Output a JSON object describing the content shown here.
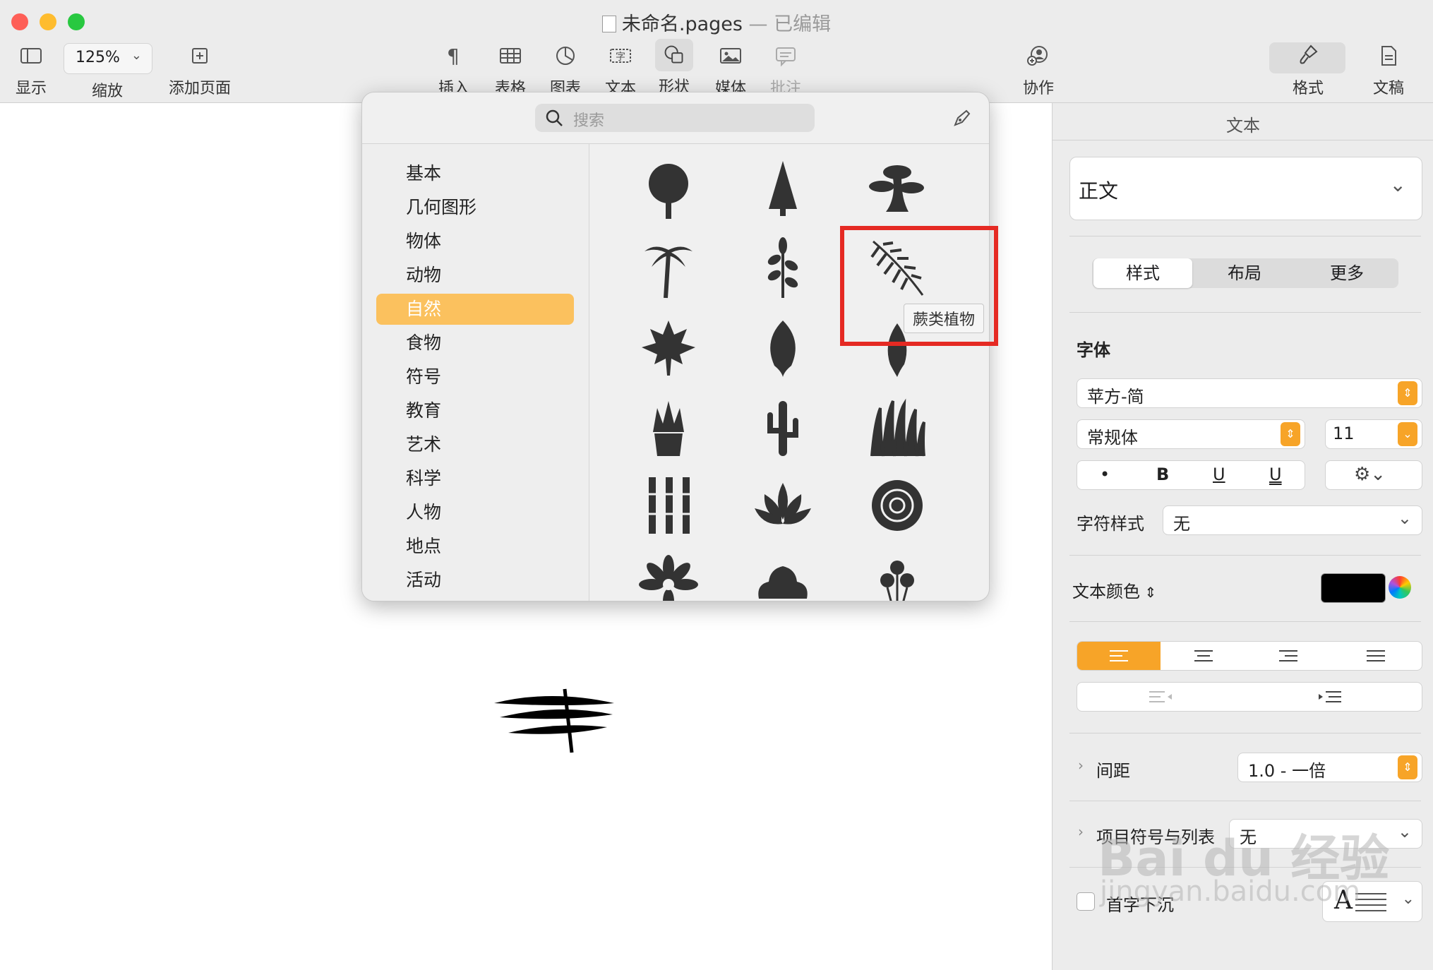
{
  "window": {
    "title": "未命名.pages",
    "title_separator": "—",
    "edited_status": "已编辑"
  },
  "toolbar": {
    "view_label": "显示",
    "zoom_value": "125%",
    "zoom_label": "缩放",
    "add_page_label": "添加页面",
    "insert_label": "插入",
    "table_label": "表格",
    "chart_label": "图表",
    "text_label": "文本",
    "shape_label": "形状",
    "media_label": "媒体",
    "comment_label": "批注",
    "collaborate_label": "协作",
    "format_label": "格式",
    "document_label": "文稿"
  },
  "shape_popover": {
    "search_placeholder": "搜索",
    "categories": [
      "基本",
      "几何图形",
      "物体",
      "动物",
      "自然",
      "食物",
      "符号",
      "教育",
      "艺术",
      "科学",
      "人物",
      "地点",
      "活动"
    ],
    "selected_category": "自然",
    "tooltip": "蕨类植物",
    "shapes": [
      "tree",
      "pine-tree",
      "bonsai",
      "palm-tree",
      "branch",
      "fern",
      "maple-leaf",
      "leaf",
      "leaf-2",
      "succulent",
      "cactus",
      "grass",
      "bamboo",
      "lotus",
      "rose",
      "daisy",
      "hibiscus",
      "flowers"
    ]
  },
  "inspector": {
    "header": "文本",
    "paragraph_style": "正文",
    "tabs": [
      "样式",
      "布局",
      "更多"
    ],
    "font_section": "字体",
    "font_family": "苹方-简",
    "font_weight": "常规体",
    "font_size": "11",
    "format_buttons": [
      "•",
      "B",
      "U",
      "U"
    ],
    "char_style_label": "字符样式",
    "char_style_value": "无",
    "text_color_label": "文本颜色",
    "text_color_value": "#000000",
    "spacing_label": "间距",
    "spacing_value": "1.0 - 一倍",
    "bullets_label": "项目符号与列表",
    "bullets_value": "无",
    "dropcap_label": "首字下沉",
    "dropcap_glyph": "A"
  },
  "watermark": {
    "brand": "Bai du 经验",
    "url": "jingyan.baidu.com"
  },
  "colors": {
    "accent": "#f7a428",
    "selected_category": "#fbc15e",
    "highlight": "#e52a23",
    "traffic_red": "#fe5f57",
    "traffic_yellow": "#febc2e",
    "traffic_green": "#28c840"
  }
}
